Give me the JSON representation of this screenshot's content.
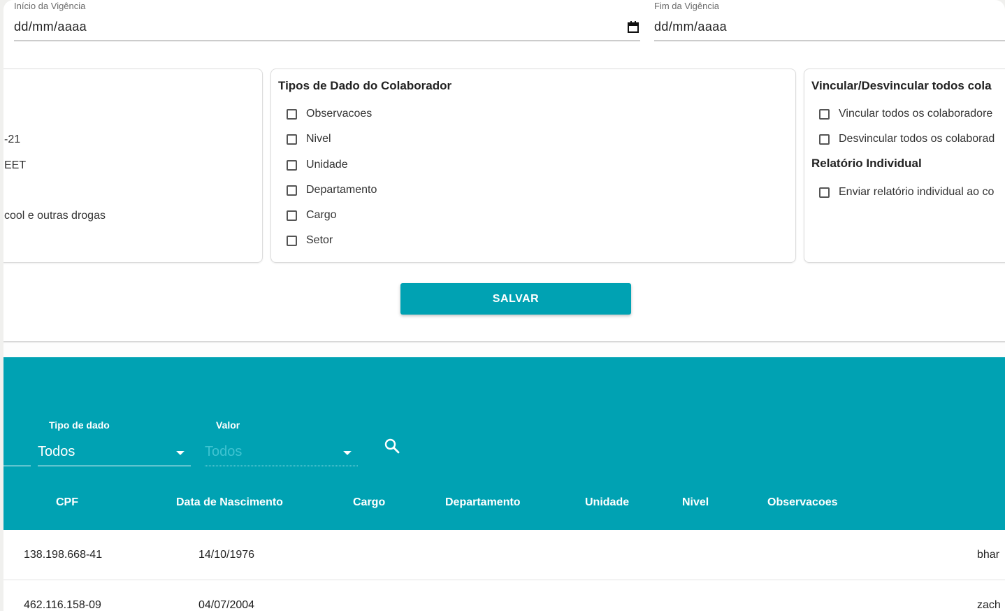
{
  "dates": {
    "inicio": {
      "label": "Início da Vigência",
      "value": "dd/mm/aaaa"
    },
    "fim": {
      "label": "Fim da Vigência",
      "value": "dd/mm/aaaa"
    }
  },
  "left_card": {
    "lines": [
      "-21",
      "EET",
      "cool e outras drogas"
    ]
  },
  "tipos_card": {
    "title": "Tipos de Dado do Colaborador",
    "options": [
      "Observacoes",
      "Nivel",
      "Unidade",
      "Departamento",
      "Cargo",
      "Setor"
    ]
  },
  "vincular_card": {
    "title": "Vincular/Desvincular todos cola",
    "options": [
      "Vincular todos os colaboradore",
      "Desvincular todos os colaborad"
    ],
    "relatorio_title": "Relatório Individual",
    "relatorio_option": "Enviar relatório individual ao co"
  },
  "save_label": "SALVAR",
  "filters": {
    "tipo": {
      "label": "Tipo de dado",
      "value": "Todos"
    },
    "valor": {
      "label": "Valor",
      "placeholder": "Todos"
    }
  },
  "table": {
    "columns": [
      "CPF",
      "Data de Nascimento",
      "Cargo",
      "Departamento",
      "Unidade",
      "Nivel",
      "Observacoes"
    ],
    "rows": [
      {
        "cpf": "138.198.668-41",
        "nascimento": "14/10/1976",
        "extra": "bhar"
      },
      {
        "cpf": "462.116.158-09",
        "nascimento": "04/07/2004",
        "extra": "zach"
      }
    ]
  },
  "colors": {
    "accent": "#00a2b3"
  }
}
